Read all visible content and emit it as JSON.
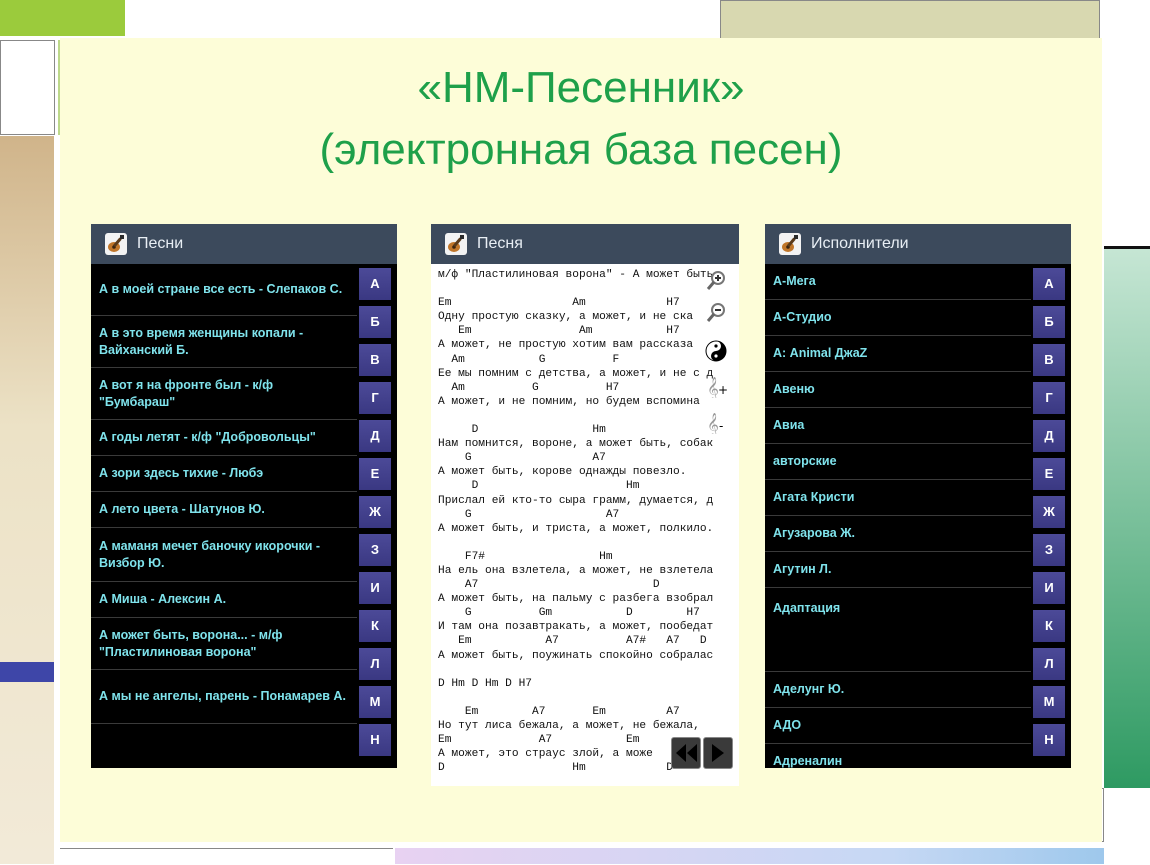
{
  "slide": {
    "title_line1": "«НМ-Песенник»",
    "title_line2": "(электронная база песен)"
  },
  "colors": {
    "title_green": "#1ea04a",
    "slide_bg": "#fdfdd8",
    "actionbar": "#3c4a5c",
    "row_text": "#7fe3ec",
    "index_bg": "#3f3d8a"
  },
  "screen_songs": {
    "title": "Песни",
    "items": [
      "А в моей стране все есть - Слепаков С.",
      "А в это время женщины копали - Вайханский Б.",
      "А вот я на фронте был - к/ф \"Бумбараш\"",
      "А годы летят - к/ф \"Добровольцы\"",
      "А зори здесь тихие - Любэ",
      "А лето цвета - Шатунов Ю.",
      "А маманя мечет баночку икорочки - Визбор Ю.",
      "А Миша - Алексин А.",
      "А может быть, ворона... - м/ф \"Пластилиновая ворона\"",
      "А мы не ангелы, парень - Понамарев А."
    ],
    "index": [
      "А",
      "Б",
      "В",
      "Г",
      "Д",
      "Е",
      "Ж",
      "З",
      "И",
      "К",
      "Л",
      "М",
      "Н"
    ]
  },
  "screen_song": {
    "title": "Песня",
    "lyrics": "м/ф \"Пластилиновая ворона\" - А может быть\n\nEm                  Am            H7\nОдну простую сказку, а может, и не ска\n   Em                Am           H7\nА может, не простую хотим вам рассказа\n  Am           G          F\nЕе мы помним с детства, а может, и не с д\n  Am          G          H7\nА может, и не помним, но будем вспомина\n\n     D                 Hm\nНам помнится, вороне, а может быть, собак\n    G                  A7\nА может быть, корове однажды повезло.\n     D                      Hm\nПрислал ей кто-то сыра грамм, думается, д\n    G                    A7\nА может быть, и триста, а может, полкило.\n\n    F7#                 Hm\nНа ель она взлетела, а может, не взлетела\n    A7                          D\nА может быть, на пальму с разбега взобрал\n    G          Gm           D        H7\nИ там она позавтракать, а может, пообедат\n   Em           A7          A7#   A7   D\nА может быть, поужинать спокойно собралас\n\nD Hm D Hm D H7\n\n    Em        A7       Em         A7\nНо тут лиса бежала, а может, не бежала,\nEm             A7           Em\nА может, это страус злой, а може\nD                   Hm            D",
    "tools": [
      "zoom-in",
      "zoom-out",
      "yin-yang",
      "treble-clef-plus",
      "treble-clef-minus"
    ]
  },
  "screen_artists": {
    "title": "Исполнители",
    "items": [
      "А-Мега",
      "А-Студио",
      "А: Animal ДжаZ",
      "Авеню",
      "Авиа",
      "авторские",
      "Агата Кристи",
      "Агузарова Ж.",
      "Агутин Л.",
      "Адаптация",
      "",
      "Аделунг Ю.",
      "АДО",
      "Адреналин"
    ],
    "index": [
      "А",
      "Б",
      "В",
      "Г",
      "Д",
      "Е",
      "Ж",
      "З",
      "И",
      "К",
      "Л",
      "М",
      "Н"
    ]
  }
}
